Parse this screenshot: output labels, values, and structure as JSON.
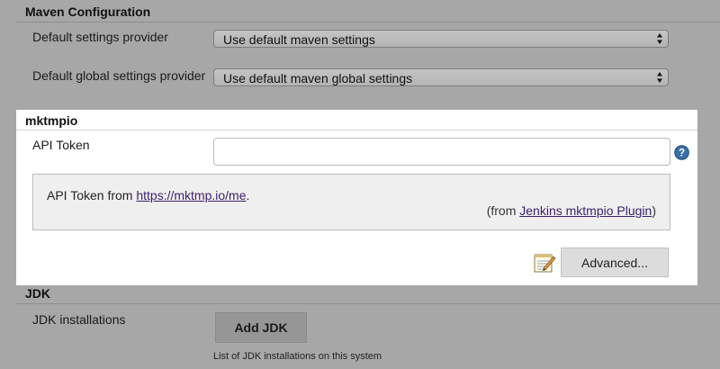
{
  "maven": {
    "title": "Maven Configuration",
    "settings_label": "Default settings provider",
    "settings_value": "Use default maven settings",
    "global_label": "Default global settings provider",
    "global_value": "Use default maven global settings"
  },
  "mktmpio": {
    "title": "mktmpio",
    "api_token_label": "API Token",
    "api_token_value": "",
    "help_prefix": "API Token from ",
    "help_link": "https://mktmp.io/me",
    "help_suffix": ".",
    "from_prefix": "(from ",
    "from_link": "Jenkins mktmpio Plugin",
    "from_suffix": ")",
    "advanced_label": "Advanced..."
  },
  "jdk": {
    "title": "JDK",
    "installations_label": "JDK installations",
    "add_button_label": "Add JDK",
    "hint": "List of JDK installations on this system"
  },
  "icons": {
    "help": "help-icon",
    "notepad": "notepad-icon",
    "select_arrows": "up-down-arrows-icon"
  },
  "colors": {
    "page_bg": "#a7a7a7",
    "panel_bg": "#ffffff",
    "link": "#3a1f6e",
    "help_icon": "#3a6ea8"
  }
}
